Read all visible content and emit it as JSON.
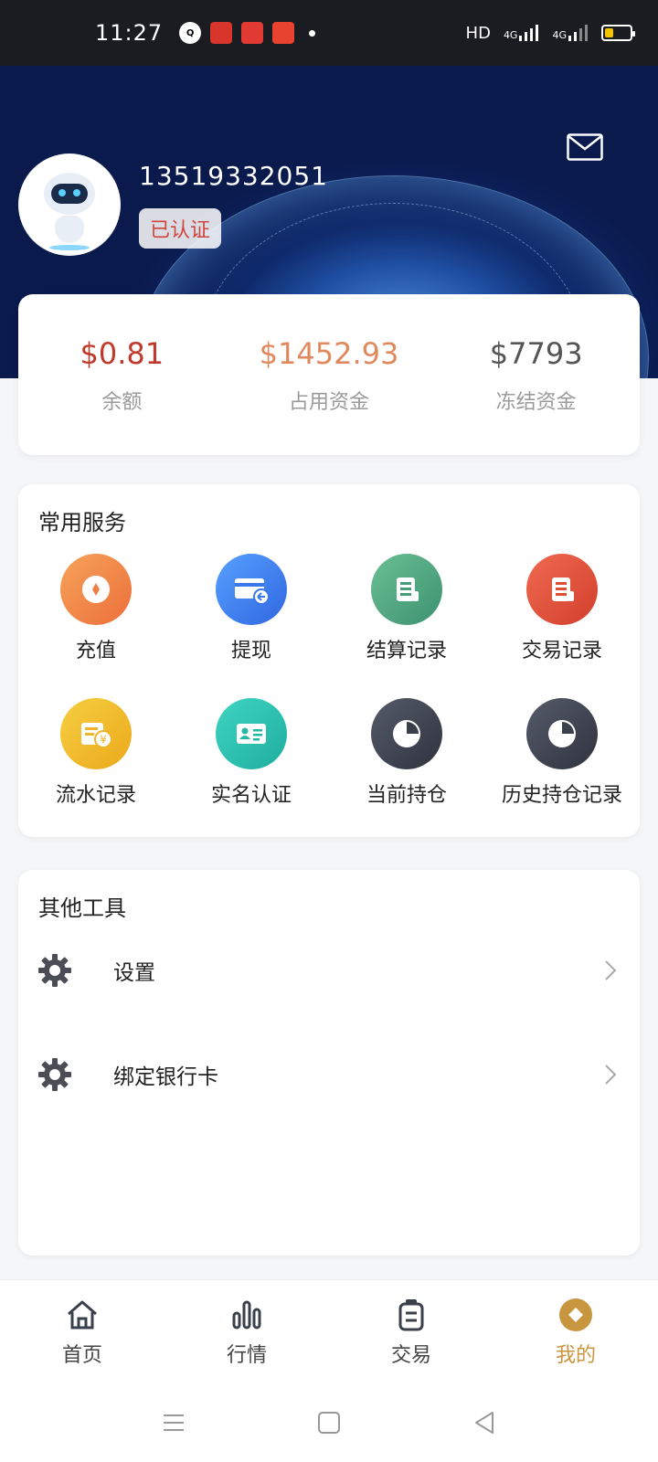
{
  "status_bar": {
    "time": "11:27",
    "network_label": "HD",
    "signal_label_1": "4G",
    "signal_label_2": "4G",
    "battery_level_percent": 35
  },
  "header": {
    "username": "13519332051",
    "verify_badge": "已认证",
    "mail_icon": "mail-icon"
  },
  "balances": [
    {
      "value": "$0.81",
      "label": "余额",
      "color": "#c0392b"
    },
    {
      "value": "$1452.93",
      "label": "占用资金",
      "color": "#e0895e"
    },
    {
      "value": "$7793",
      "label": "冻结资金",
      "color": "#555555"
    }
  ],
  "services": {
    "title": "常用服务",
    "items": [
      {
        "label": "充值",
        "icon": "recharge-icon",
        "color": "#f0884a"
      },
      {
        "label": "提现",
        "icon": "withdraw-card-icon",
        "color": "#3f7ff0"
      },
      {
        "label": "结算记录",
        "icon": "settlement-doc-icon",
        "color": "#55a67e"
      },
      {
        "label": "交易记录",
        "icon": "trade-doc-icon",
        "color": "#e0533c"
      },
      {
        "label": "流水记录",
        "icon": "yuan-ledger-icon",
        "color": "#f2bd2e"
      },
      {
        "label": "实名认证",
        "icon": "id-card-icon",
        "color": "#2fc4b3"
      },
      {
        "label": "当前持仓",
        "icon": "pie-chart-icon",
        "color": "#3a3f4c"
      },
      {
        "label": "历史持仓记录",
        "icon": "pie-chart-icon",
        "color": "#3a3f4c"
      }
    ]
  },
  "tools": {
    "title": "其他工具",
    "items": [
      {
        "label": "设置",
        "icon": "gear-icon"
      },
      {
        "label": "绑定银行卡",
        "icon": "gear-icon"
      }
    ]
  },
  "bottom_nav": [
    {
      "label": "首页",
      "icon": "home-icon",
      "active": false
    },
    {
      "label": "行情",
      "icon": "bar-chart-icon",
      "active": false
    },
    {
      "label": "交易",
      "icon": "trade-icon",
      "active": false
    },
    {
      "label": "我的",
      "icon": "profile-diamond-icon",
      "active": true
    }
  ],
  "accent_color": "#c8963e"
}
